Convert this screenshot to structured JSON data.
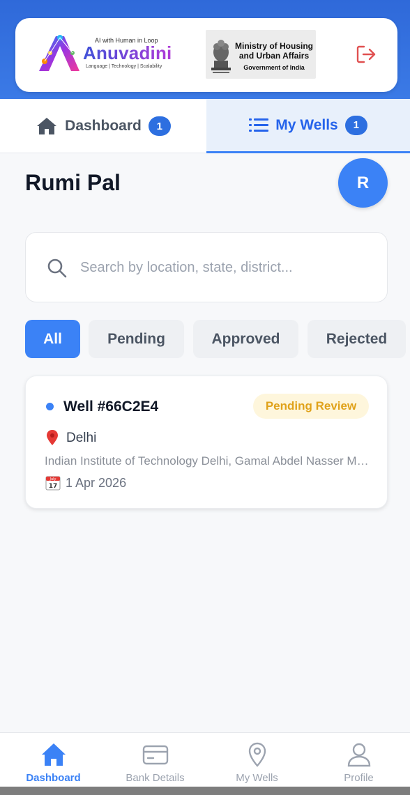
{
  "header": {
    "logo": {
      "tagline": "AI with Human in Loop",
      "name": "Anuvadini",
      "subtitle": "Language | Technology | Scalability"
    },
    "ministry": {
      "line1": "Ministry of Housing",
      "line2": "and Urban Affairs",
      "line3": "Government of India"
    },
    "logout_icon": "logout-icon",
    "accent": "#e05050"
  },
  "tabs": [
    {
      "label": "Dashboard",
      "badge": "1",
      "icon": "home-icon",
      "active": false
    },
    {
      "label": "My Wells",
      "badge": "1",
      "icon": "list-icon",
      "active": true
    }
  ],
  "user": {
    "name": "Rumi Pal",
    "initial": "R"
  },
  "search": {
    "placeholder": "Search by location, state, district...",
    "value": ""
  },
  "filters": [
    {
      "label": "All",
      "active": true
    },
    {
      "label": "Pending",
      "active": false
    },
    {
      "label": "Approved",
      "active": false
    },
    {
      "label": "Rejected",
      "active": false
    }
  ],
  "wells": [
    {
      "title": "Well #66C2E4",
      "status": "Pending Review",
      "city": "Delhi",
      "address": "Indian Institute of Technology Delhi, Gamal Abdel Nasser Marg",
      "date": "1 Apr 2026",
      "calendar_icon": {
        "month": "July",
        "day": "17"
      }
    }
  ],
  "bottom_nav": [
    {
      "label": "Dashboard",
      "icon": "home-icon",
      "active": true
    },
    {
      "label": "Bank Details",
      "icon": "card-icon",
      "active": false
    },
    {
      "label": "My Wells",
      "icon": "map-pin-icon",
      "active": false
    },
    {
      "label": "Profile",
      "icon": "user-icon",
      "active": false
    }
  ],
  "colors": {
    "primary": "#3b82f6",
    "header_blue": "#2f69d9",
    "pending": "#e0a21a",
    "pending_bg": "#fef6dc"
  }
}
